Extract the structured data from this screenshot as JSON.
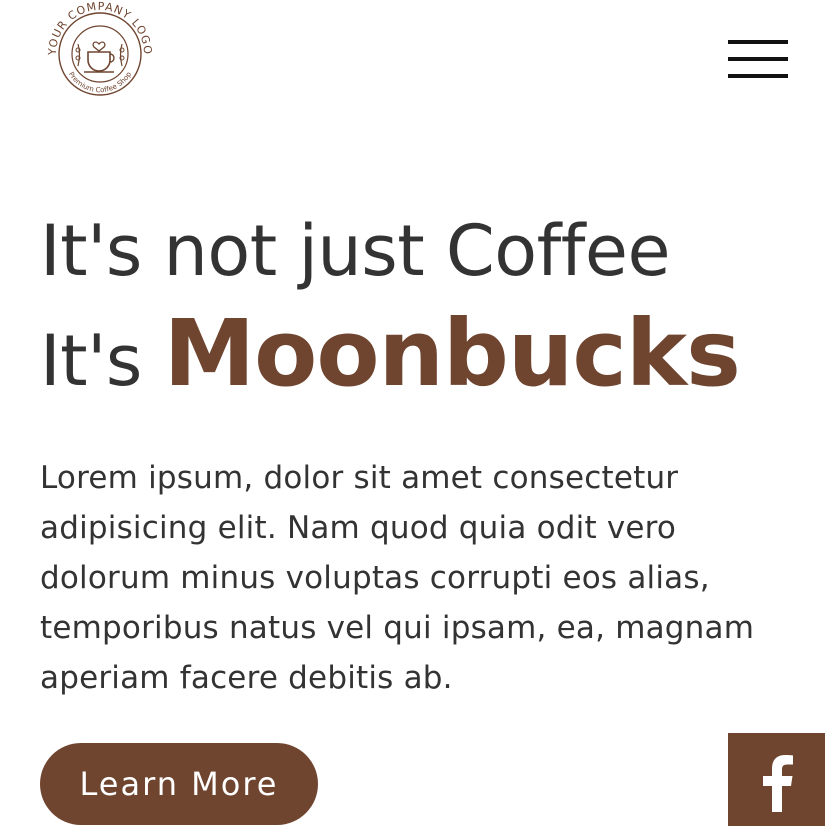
{
  "logo": {
    "top_text": "YOUR COMPANY LOGO",
    "bottom_text": "Premium Coffee Shop",
    "icon": "coffee-cup-icon"
  },
  "header": {
    "menu_icon": "hamburger-menu-icon"
  },
  "hero": {
    "title_line1": "It's not just Coffee",
    "title_line2_prefix": "It's ",
    "brand_name": "Moonbucks",
    "description": "Lorem ipsum, dolor sit amet consectetur adipisicing elit. Nam quod quia odit vero dolorum minus voluptas corrupti eos alias, temporibus natus vel qui ipsam, ea, magnam aperiam facere debitis ab.",
    "cta_label": "Learn More"
  },
  "social": {
    "facebook_icon": "facebook-icon"
  },
  "colors": {
    "accent": "#6f4530",
    "text": "#333333",
    "background": "#ffffff"
  }
}
